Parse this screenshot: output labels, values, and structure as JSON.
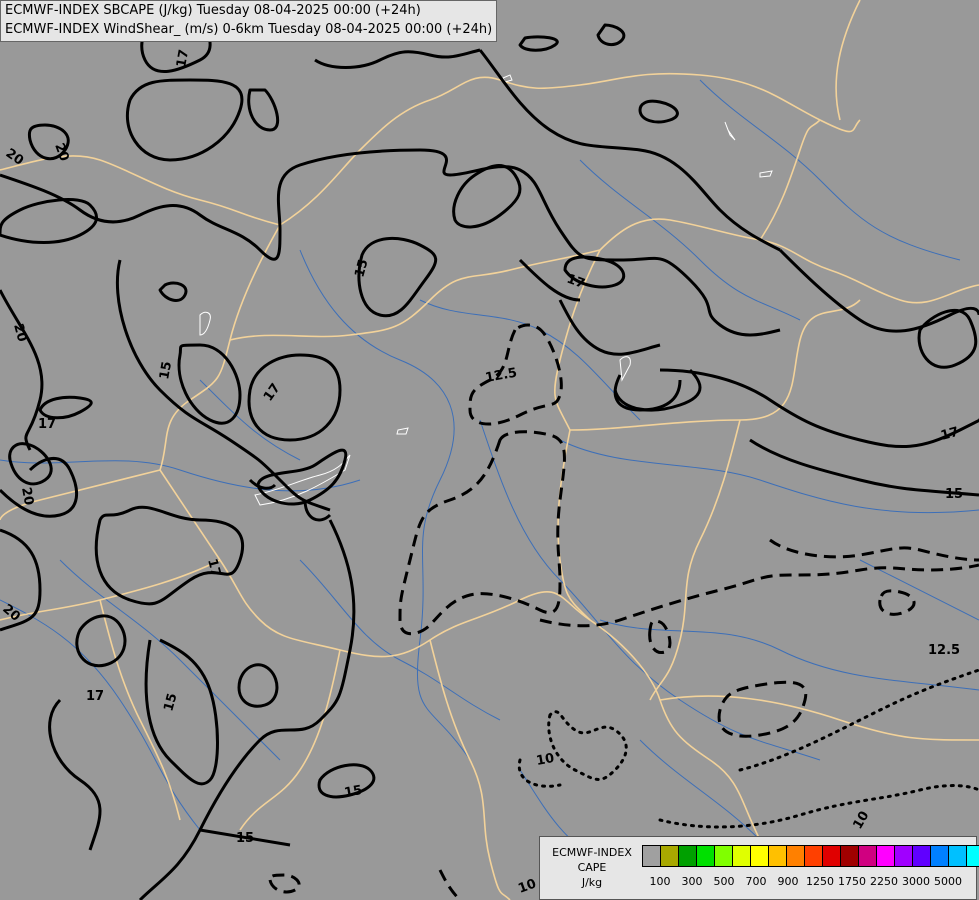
{
  "header": {
    "line1": "ECMWF-INDEX SBCAPE (J/kg) Tuesday 08-04-2025 00:00 (+24h)",
    "line2": "ECMWF-INDEX WindShear_ (m/s) 0-6km Tuesday 08-04-2025 00:00 (+24h)"
  },
  "legend": {
    "line1": "ECMWF-INDEX",
    "line2": "CAPE",
    "line3": "J/kg",
    "colors": [
      "#a0a0a0",
      "#a8a800",
      "#00a000",
      "#00e000",
      "#80ff00",
      "#e0ff00",
      "#ffff00",
      "#ffc000",
      "#ff8000",
      "#ff4000",
      "#e00000",
      "#a00000",
      "#d00080",
      "#ff00ff",
      "#a000ff",
      "#6000ff",
      "#0080ff",
      "#00c0ff",
      "#00ffff",
      "#ffffff"
    ],
    "ticks": [
      "100",
      "300",
      "500",
      "700",
      "900",
      "1250",
      "1750",
      "2250",
      "3000",
      "5000"
    ]
  },
  "contour_labels": {
    "l1": "17",
    "l2": "20",
    "l3": "20",
    "l4": "15",
    "l5": "17",
    "l6": "20",
    "l7": "15",
    "l8": "17",
    "l9": "17",
    "l10": "12.5",
    "l11": "20",
    "l12": "17",
    "l13": "17",
    "l14": "15",
    "l15": "20",
    "l16": "15",
    "l17": "17",
    "l18": "15",
    "l19": "15",
    "l20": "10",
    "l21": "12.5",
    "l22": "10",
    "l23": "10",
    "l24": "10"
  }
}
